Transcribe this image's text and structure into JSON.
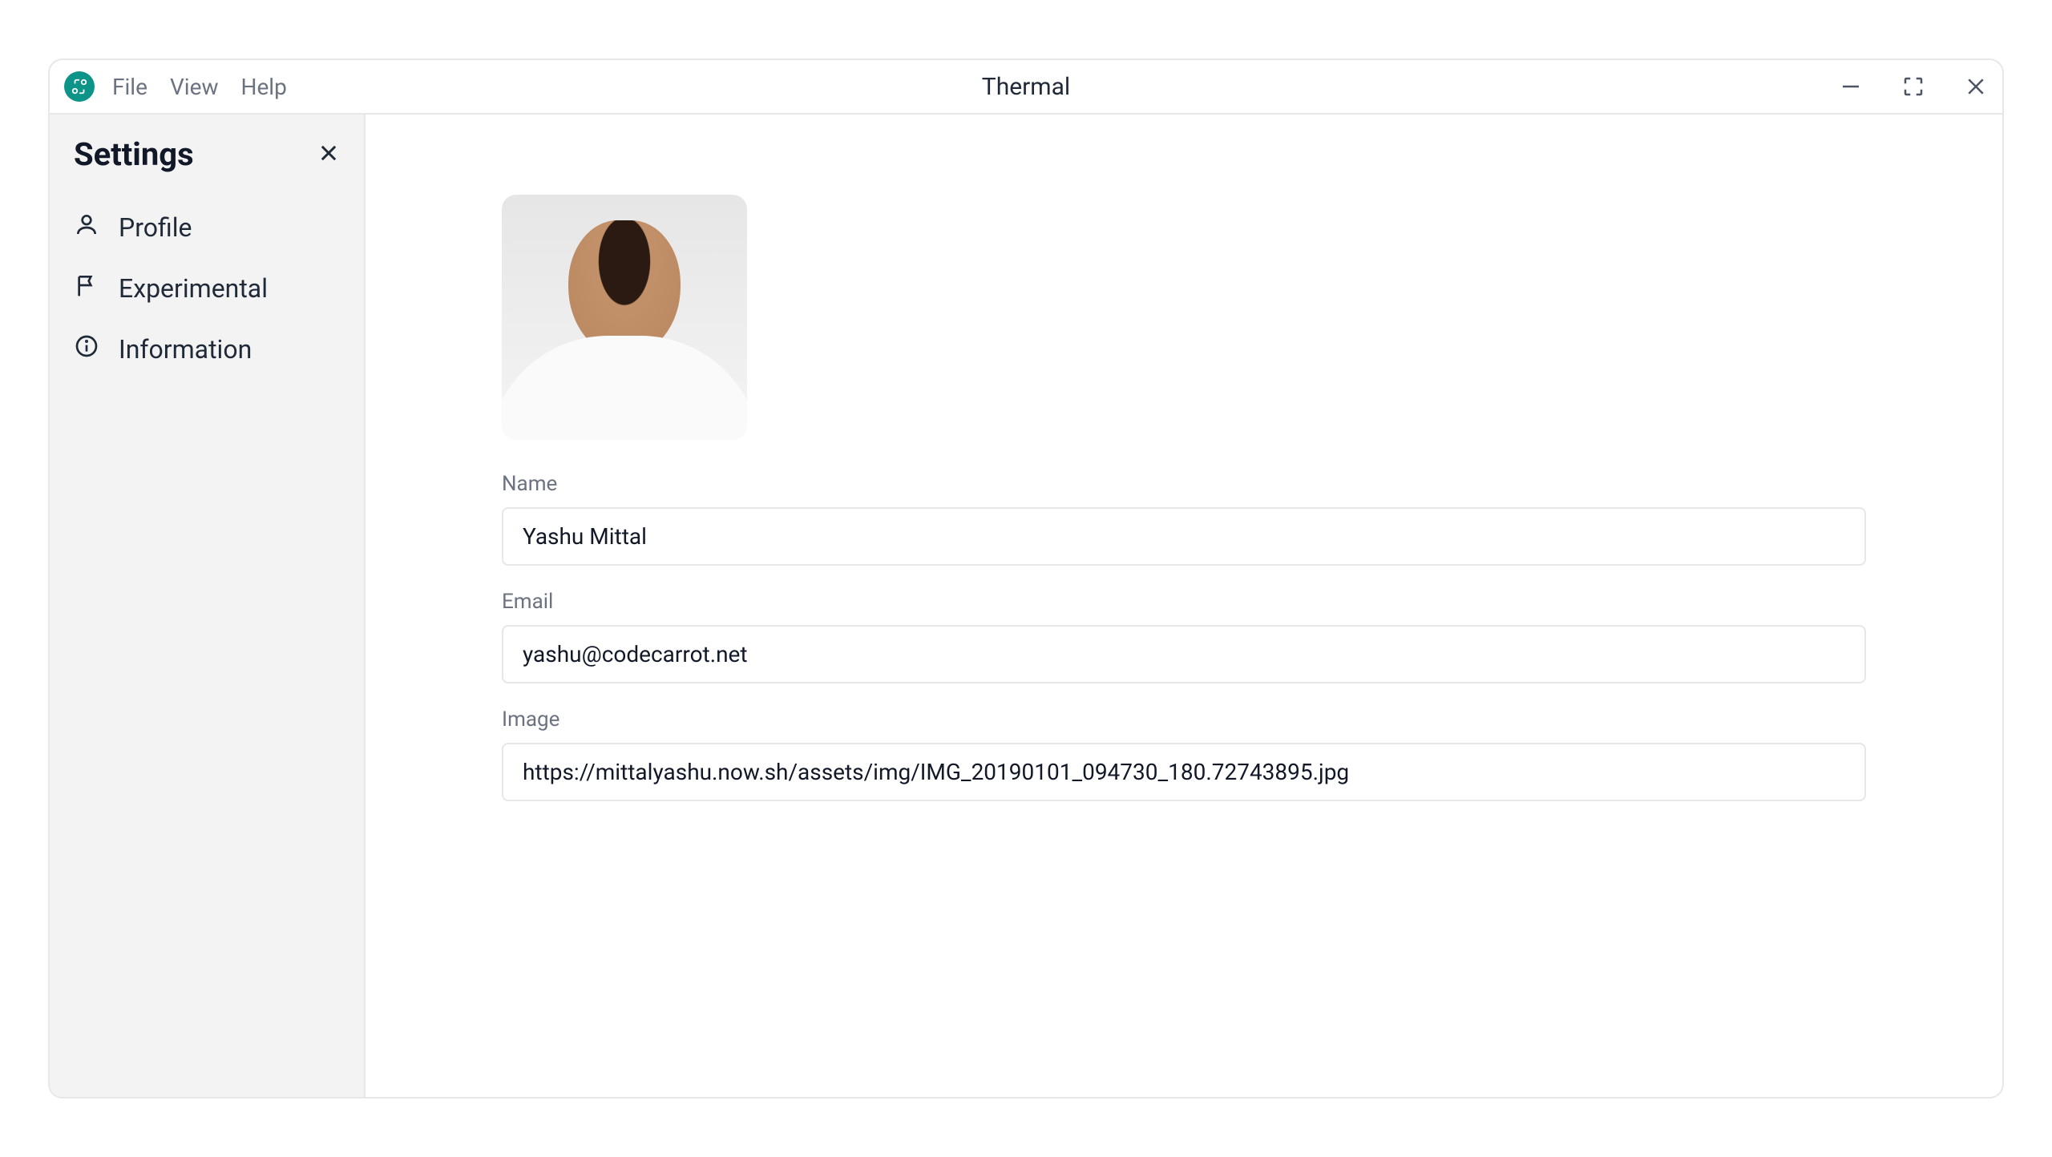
{
  "window": {
    "title": "Thermal"
  },
  "menu": {
    "file": "File",
    "view": "View",
    "help": "Help"
  },
  "sidebar": {
    "title": "Settings",
    "items": [
      {
        "label": "Profile"
      },
      {
        "label": "Experimental"
      },
      {
        "label": "Information"
      }
    ]
  },
  "profile": {
    "name_label": "Name",
    "name_value": "Yashu Mittal",
    "email_label": "Email",
    "email_value": "yashu@codecarrot.net",
    "image_label": "Image",
    "image_value": "https://mittalyashu.now.sh/assets/img/IMG_20190101_094730_180.72743895.jpg"
  }
}
